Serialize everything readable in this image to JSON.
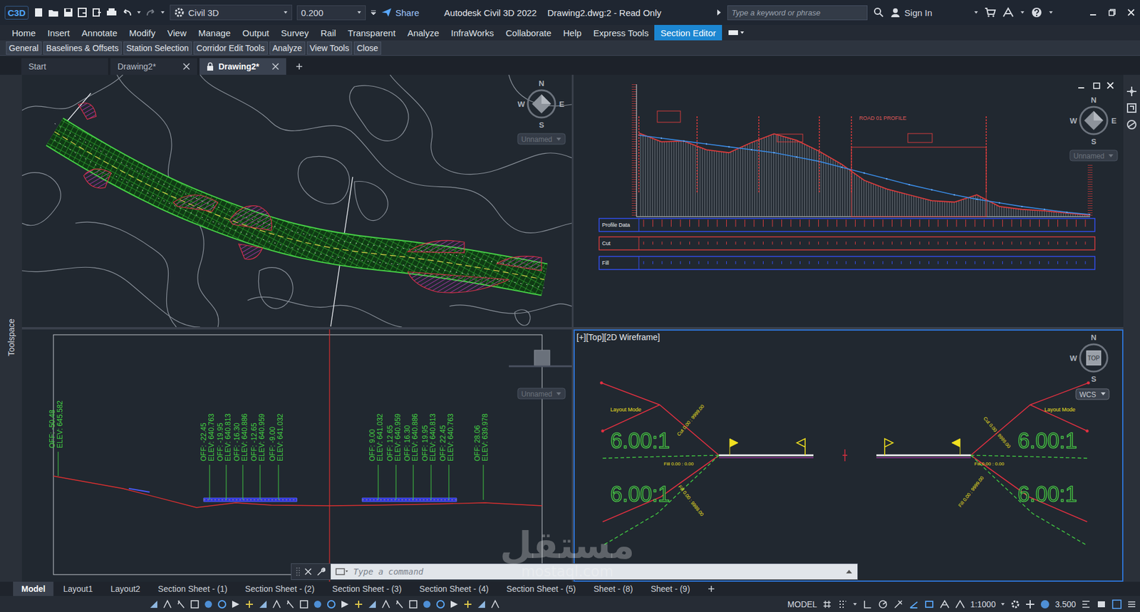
{
  "app": {
    "logo": "C3D",
    "workspace": "Civil 3D",
    "value": "0.200",
    "share": "Share",
    "title": "Autodesk Civil 3D 2022",
    "document": "Drawing2.dwg:2 - Read Only",
    "search_placeholder": "Type a keyword or phrase",
    "sign_in": "Sign In"
  },
  "ribbon_tabs": [
    {
      "label": "Home",
      "selected": false
    },
    {
      "label": "Insert",
      "selected": false
    },
    {
      "label": "Annotate",
      "selected": false
    },
    {
      "label": "Modify",
      "selected": false
    },
    {
      "label": "View",
      "selected": false
    },
    {
      "label": "Manage",
      "selected": false
    },
    {
      "label": "Output",
      "selected": false
    },
    {
      "label": "Survey",
      "selected": false
    },
    {
      "label": "Rail",
      "selected": false
    },
    {
      "label": "Transparent",
      "selected": false
    },
    {
      "label": "Analyze",
      "selected": false
    },
    {
      "label": "InfraWorks",
      "selected": false
    },
    {
      "label": "Collaborate",
      "selected": false
    },
    {
      "label": "Help",
      "selected": false
    },
    {
      "label": "Express Tools",
      "selected": false
    },
    {
      "label": "Section Editor",
      "selected": true
    }
  ],
  "ribbon_panels": [
    "General",
    "Baselines & Offsets",
    "Station Selection",
    "Corridor Edit Tools",
    "Analyze",
    "View Tools",
    "Close"
  ],
  "file_tabs": [
    {
      "label": "Start",
      "selected": false,
      "closable": false,
      "locked": false
    },
    {
      "label": "Drawing2*",
      "selected": false,
      "closable": true,
      "locked": false
    },
    {
      "label": "Drawing2*",
      "selected": true,
      "closable": true,
      "locked": true
    }
  ],
  "toolspace": "Toolspace",
  "viewports": {
    "plan": {
      "active": false,
      "compass": {
        "n": "N",
        "s": "S",
        "e": "E",
        "w": "W"
      },
      "view_name": "Unnamed"
    },
    "profile": {
      "active": false,
      "compass": {
        "n": "N",
        "s": "S",
        "e": "E",
        "w": "W"
      },
      "view_name": "Unnamed",
      "title": "ROAD 01 PROFILE",
      "bands": [
        "Profile Data",
        "Cut",
        "Fill"
      ],
      "ground": [
        658.75,
        655.75,
        656,
        653,
        652,
        655.5,
        658.5,
        656.25,
        652.5,
        648,
        642.5,
        639.5,
        637.5,
        635.5,
        635,
        637.5,
        633.5,
        632.5,
        632,
        631.25,
        630.5
      ],
      "design": [
        658,
        657,
        656,
        655,
        654,
        653,
        652,
        650.5,
        649,
        647,
        645,
        643,
        641,
        639.25,
        637.5,
        636,
        634.75,
        633.5,
        632.5,
        631.5,
        630.75
      ]
    },
    "section": {
      "active": false,
      "view_name": "Unnamed",
      "labels": [
        {
          "off": "OFF: -50.48",
          "elev": "ELEV: 645.582"
        },
        {
          "off": "OFF: -22.45",
          "elev": "ELEV: 640.763"
        },
        {
          "off": "OFF: -19.95",
          "elev": "ELEV: 640.813"
        },
        {
          "off": "OFF: -16.30",
          "elev": "ELEV: 640.886"
        },
        {
          "off": "OFF: -12.65",
          "elev": "ELEV: 640.959"
        },
        {
          "off": "OFF: -9.00",
          "elev": "ELEV: 641.032"
        },
        {
          "off": "OFF: 9.00",
          "elev": "ELEV: 641.032"
        },
        {
          "off": "OFF: 12.65",
          "elev": "ELEV: 640.959"
        },
        {
          "off": "OFF: 16.30",
          "elev": "ELEV: 640.886"
        },
        {
          "off": "OFF: 19.95",
          "elev": "ELEV: 640.813"
        },
        {
          "off": "OFF: 22.45",
          "elev": "ELEV: 640.763"
        },
        {
          "off": "OFF: 28.06",
          "elev": "ELEV: 639.978"
        }
      ]
    },
    "editor": {
      "active": true,
      "label": "[+][Top][2D Wireframe]",
      "compass": {
        "n": "N",
        "s": "S",
        "w": "W"
      },
      "cube": "TOP",
      "ucs": "WCS",
      "layout_mode": [
        "Layout Mode",
        "Layout Mode"
      ],
      "slopes": [
        "6.00:1",
        "6.00:1",
        "6.00:1",
        "6.00:1"
      ],
      "slope_labels": [
        "Cut  0.00 : 9999.00",
        "Fill  0.00 : 0.00",
        "Fill  0.00 : 9999.00",
        "Cut  0.00 : 9999.00",
        "Fill  0.00 : 0.00",
        "Fill  0.00 : 9999.00"
      ]
    }
  },
  "command_line": {
    "placeholder": "Type a command"
  },
  "layout_tabs": [
    {
      "label": "Model",
      "selected": true
    },
    {
      "label": "Layout1",
      "selected": false
    },
    {
      "label": "Layout2",
      "selected": false
    },
    {
      "label": "Section Sheet - (1)",
      "selected": false
    },
    {
      "label": "Section Sheet - (2)",
      "selected": false
    },
    {
      "label": "Section Sheet - (3)",
      "selected": false
    },
    {
      "label": "Section Sheet - (4)",
      "selected": false
    },
    {
      "label": "Section Sheet - (5)",
      "selected": false
    },
    {
      "label": "Sheet - (8)",
      "selected": false
    },
    {
      "label": "Sheet - (9)",
      "selected": false
    }
  ],
  "status_bar": {
    "mode": "MODEL",
    "scale": "1:1000",
    "value": "3.500"
  },
  "watermark": {
    "arabic": "مستقل",
    "latin": "mostaql.com"
  }
}
